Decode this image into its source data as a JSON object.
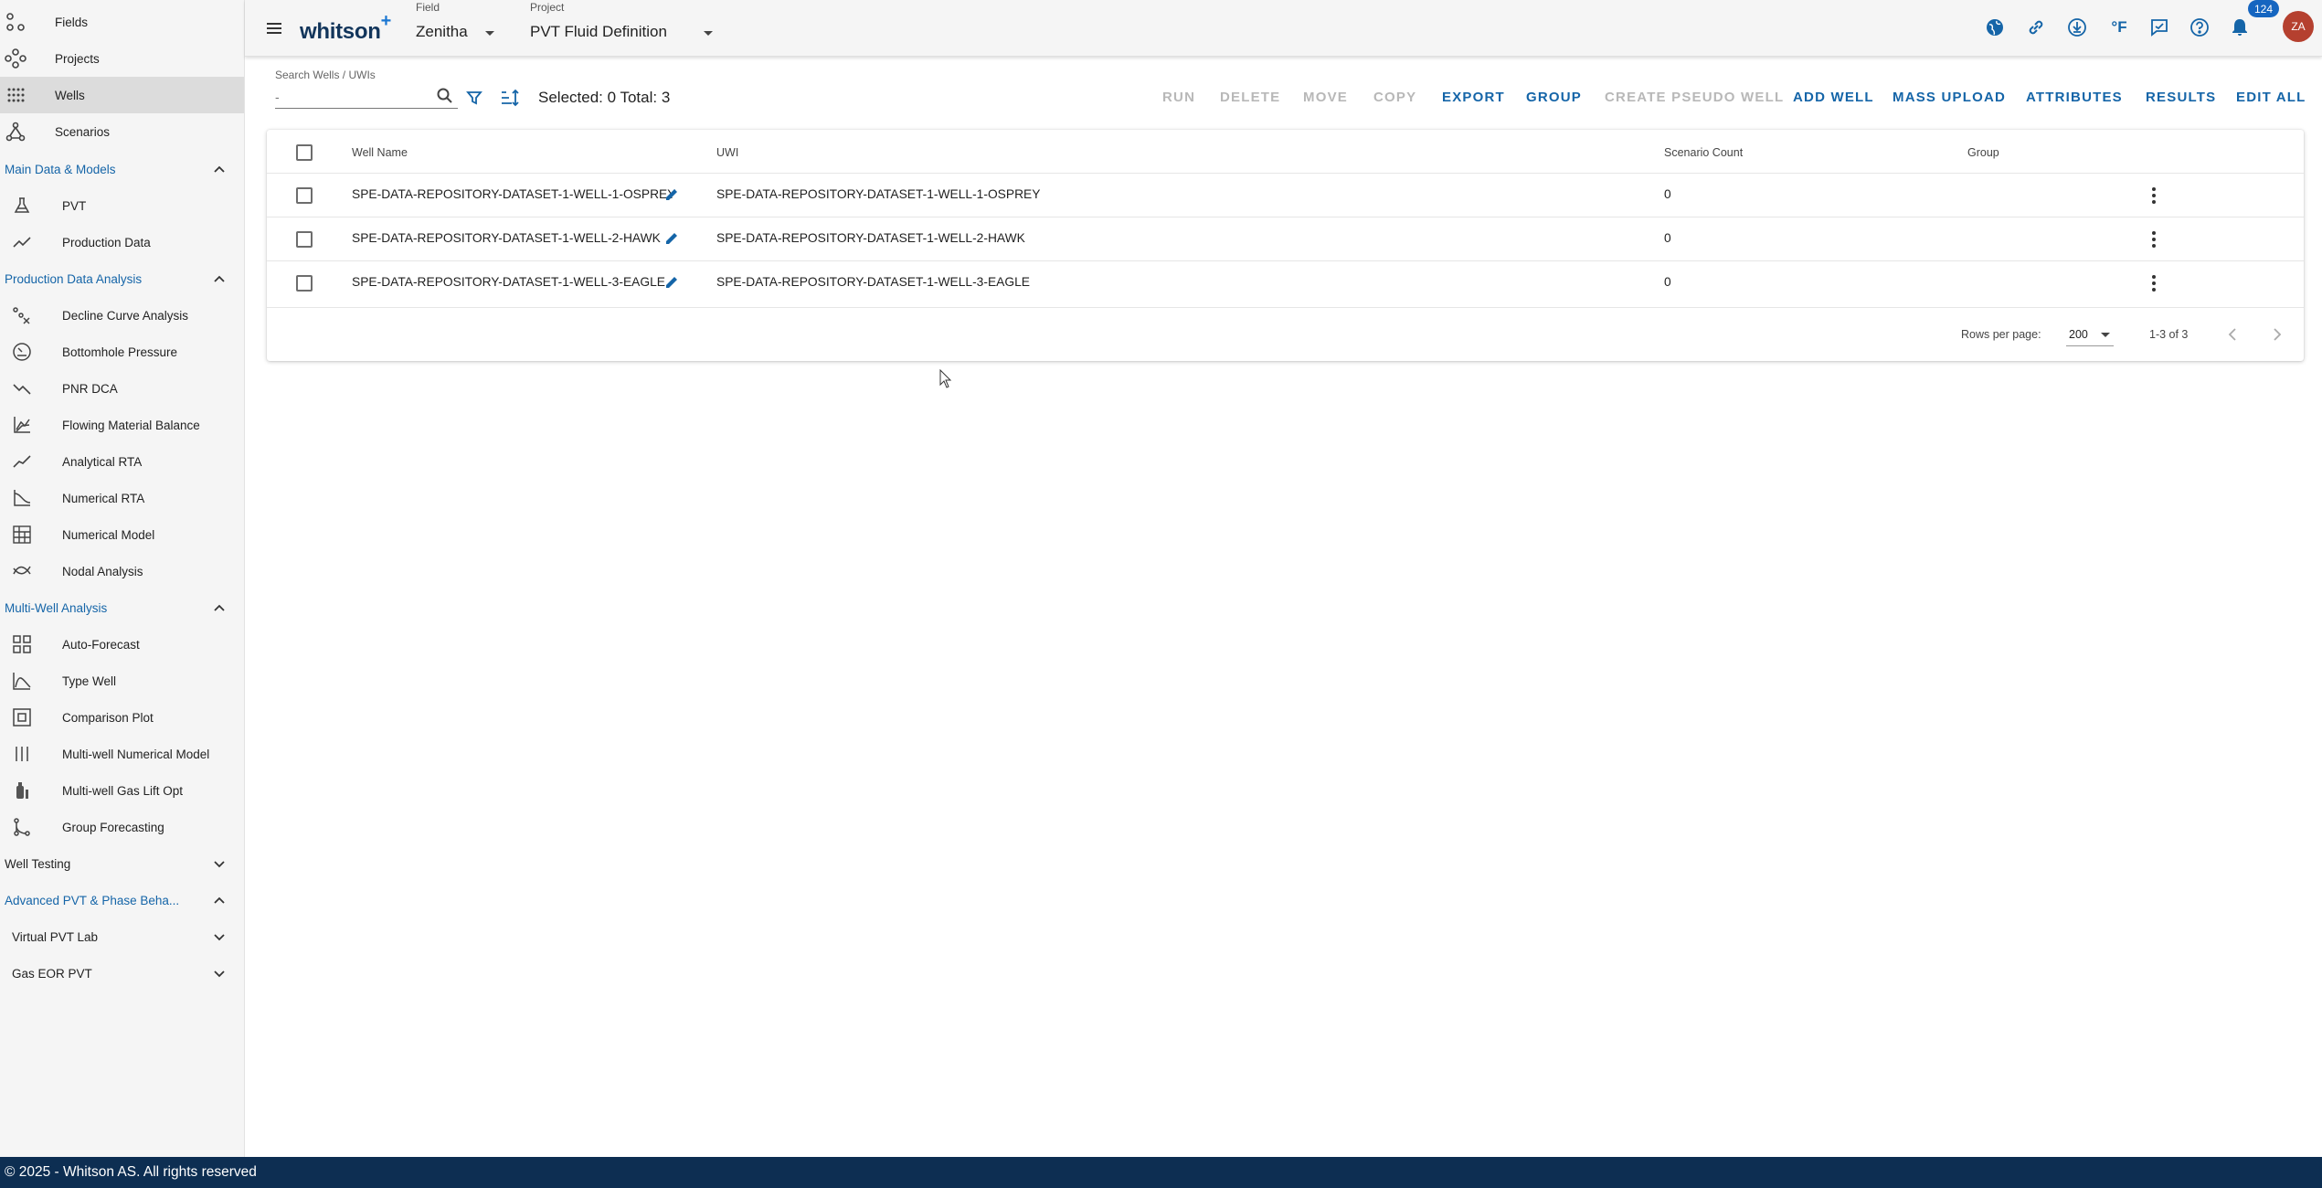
{
  "sidebar": {
    "top_items": [
      {
        "label": "Fields",
        "icon": "fields-icon"
      },
      {
        "label": "Projects",
        "icon": "projects-icon"
      },
      {
        "label": "Wells",
        "icon": "wells-icon"
      },
      {
        "label": "Scenarios",
        "icon": "scenarios-icon"
      }
    ],
    "sections": {
      "main_data": {
        "label": "Main Data & Models",
        "items": [
          {
            "label": "PVT",
            "icon": "flask-icon"
          },
          {
            "label": "Production Data",
            "icon": "line-chart-icon"
          }
        ]
      },
      "production_analysis": {
        "label": "Production Data Analysis",
        "items": [
          {
            "label": "Decline Curve Analysis",
            "icon": "decline-icon"
          },
          {
            "label": "Bottomhole Pressure",
            "icon": "gauge-icon"
          },
          {
            "label": "PNR DCA",
            "icon": "trend-down-icon"
          },
          {
            "label": "Flowing Material Balance",
            "icon": "multi-line-chart-icon"
          },
          {
            "label": "Analytical RTA",
            "icon": "analytics-line-icon"
          },
          {
            "label": "Numerical RTA",
            "icon": "curve-icon"
          },
          {
            "label": "Numerical Model",
            "icon": "grid-building-icon"
          },
          {
            "label": "Nodal Analysis",
            "icon": "nodal-icon"
          }
        ]
      },
      "multi_well": {
        "label": "Multi-Well Analysis",
        "items": [
          {
            "label": "Auto-Forecast",
            "icon": "grid-icon"
          },
          {
            "label": "Type Well",
            "icon": "bell-curve-icon"
          },
          {
            "label": "Comparison Plot",
            "icon": "compare-icon"
          },
          {
            "label": "Multi-well Numerical Model",
            "icon": "columns-icon"
          },
          {
            "label": "Multi-well Gas Lift Opt",
            "icon": "gas-cylinder-icon"
          },
          {
            "label": "Group Forecasting",
            "icon": "branch-icon"
          }
        ]
      },
      "well_testing": {
        "label": "Well Testing"
      },
      "advanced_pvt": {
        "label": "Advanced PVT & Phase Beha...",
        "items": [
          {
            "label": "Virtual PVT Lab"
          },
          {
            "label": "Gas EOR PVT"
          }
        ]
      }
    }
  },
  "header": {
    "logo": "whitson",
    "logo_plus": "+",
    "field_label": "Field",
    "field_value": "Zenitha",
    "project_label": "Project",
    "project_value": "PVT Fluid Definition",
    "unit": "°F",
    "notifications": "124",
    "avatar": "ZA"
  },
  "toolbar": {
    "search_label": "Search Wells / UWIs",
    "search_placeholder": "-",
    "selection": "Selected: 0 Total: 3",
    "actions": [
      {
        "label": "RUN",
        "enabled": false
      },
      {
        "label": "DELETE",
        "enabled": false
      },
      {
        "label": "MOVE",
        "enabled": false
      },
      {
        "label": "COPY",
        "enabled": false
      },
      {
        "label": "EXPORT",
        "enabled": true
      },
      {
        "label": "GROUP",
        "enabled": true
      },
      {
        "label": "CREATE PSEUDO WELL",
        "enabled": false
      },
      {
        "label": "ADD WELL",
        "enabled": true
      },
      {
        "label": "MASS UPLOAD",
        "enabled": true
      },
      {
        "label": "ATTRIBUTES",
        "enabled": true
      },
      {
        "label": "RESULTS",
        "enabled": true
      },
      {
        "label": "EDIT ALL",
        "enabled": true
      }
    ]
  },
  "table": {
    "columns": [
      "Well Name",
      "UWI",
      "Scenario Count",
      "Group"
    ],
    "rows": [
      {
        "well_name": "SPE-DATA-REPOSITORY-DATASET-1-WELL-1-OSPREY",
        "uwi": "SPE-DATA-REPOSITORY-DATASET-1-WELL-1-OSPREY",
        "scenario_count": "0",
        "group": ""
      },
      {
        "well_name": "SPE-DATA-REPOSITORY-DATASET-1-WELL-2-HAWK",
        "uwi": "SPE-DATA-REPOSITORY-DATASET-1-WELL-2-HAWK",
        "scenario_count": "0",
        "group": ""
      },
      {
        "well_name": "SPE-DATA-REPOSITORY-DATASET-1-WELL-3-EAGLE",
        "uwi": "SPE-DATA-REPOSITORY-DATASET-1-WELL-3-EAGLE",
        "scenario_count": "0",
        "group": ""
      }
    ],
    "rows_per_page_label": "Rows per page:",
    "rows_per_page": "200",
    "range": "1-3 of 3"
  },
  "footer": {
    "text": "© 2025 - Whitson AS. All rights reserved"
  },
  "colors": {
    "accent": "#1565a8",
    "footer": "#0d2e52",
    "avatar": "#b5402f",
    "disabled": "#b8b8b8"
  }
}
